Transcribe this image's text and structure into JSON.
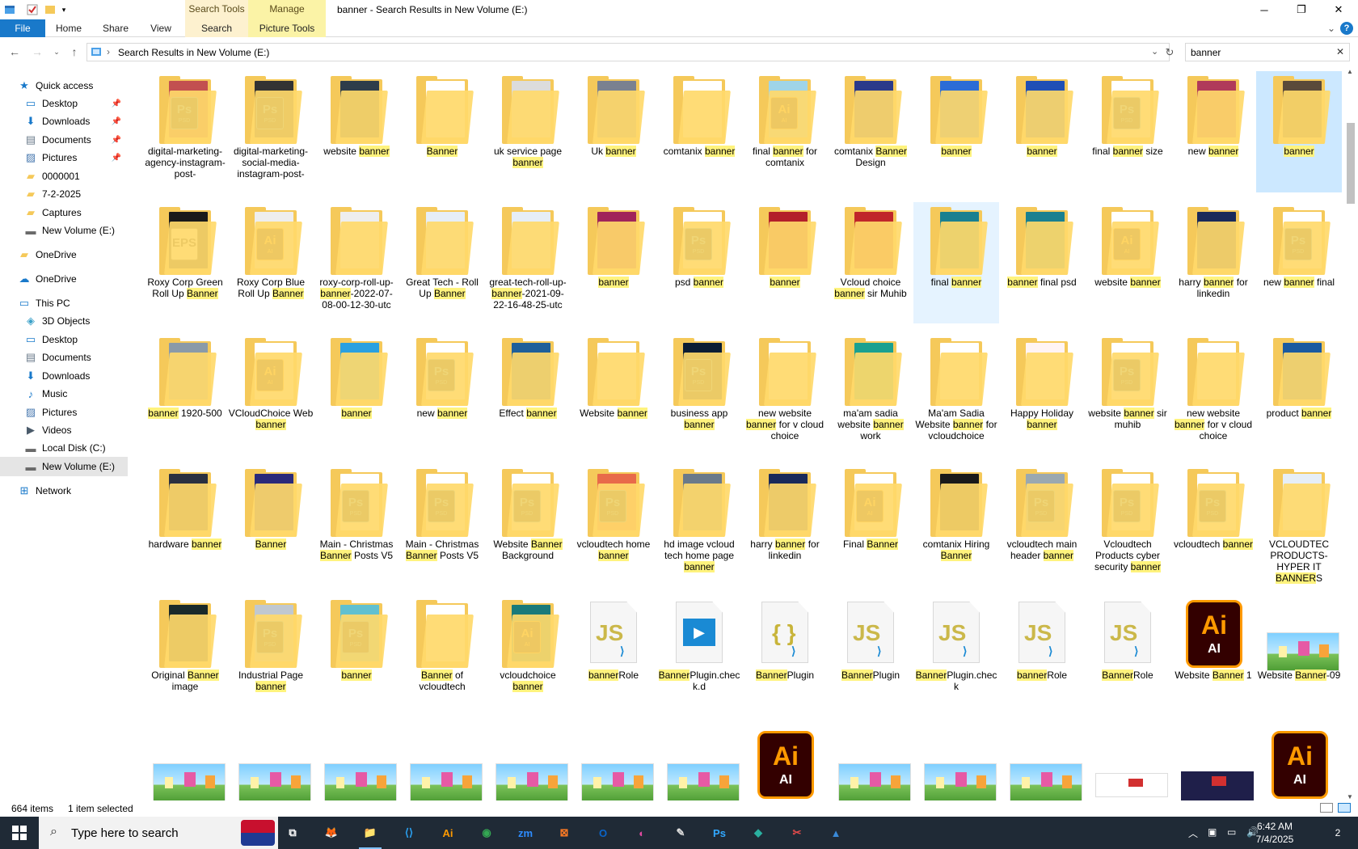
{
  "window": {
    "title": "banner - Search Results in New Volume (E:)",
    "controls": {
      "minimize": "─",
      "maximize": "❐",
      "close": "✕"
    }
  },
  "ribbon": {
    "context_tabs": [
      {
        "group": "Search Tools",
        "tab": "Search"
      },
      {
        "group": "Manage",
        "tab": "Picture Tools"
      }
    ],
    "tabs": [
      "File",
      "Home",
      "Share",
      "View"
    ],
    "collapse": "⌄",
    "help": "?"
  },
  "address": {
    "path": "Search Results in New Volume (E:)",
    "search_query": "banner",
    "sep": "›"
  },
  "nav_pane": [
    {
      "label": "Quick access",
      "icon": "star-icon",
      "pinned": false
    },
    {
      "label": "Desktop",
      "icon": "desktop-icon",
      "pinned": true
    },
    {
      "label": "Downloads",
      "icon": "download-icon",
      "pinned": true
    },
    {
      "label": "Documents",
      "icon": "documents-icon",
      "pinned": true
    },
    {
      "label": "Pictures",
      "icon": "pictures-icon",
      "pinned": true
    },
    {
      "label": "0000001",
      "icon": "folder-icon",
      "pinned": false
    },
    {
      "label": "7-2-2025",
      "icon": "folder-icon",
      "pinned": false
    },
    {
      "label": "Captures",
      "icon": "folder-icon",
      "pinned": false
    },
    {
      "label": "New Volume (E:)",
      "icon": "drive-icon",
      "pinned": false
    },
    {
      "label": "OneDrive",
      "icon": "folder-icon",
      "pinned": false
    },
    {
      "label": "OneDrive",
      "icon": "cloud-icon",
      "pinned": false
    },
    {
      "label": "This PC",
      "icon": "pc-icon",
      "pinned": false
    },
    {
      "label": "3D Objects",
      "icon": "cube-icon",
      "pinned": false
    },
    {
      "label": "Desktop",
      "icon": "desktop-icon",
      "pinned": false
    },
    {
      "label": "Documents",
      "icon": "documents-icon",
      "pinned": false
    },
    {
      "label": "Downloads",
      "icon": "download-icon",
      "pinned": false
    },
    {
      "label": "Music",
      "icon": "music-icon",
      "pinned": false
    },
    {
      "label": "Pictures",
      "icon": "pictures-icon",
      "pinned": false
    },
    {
      "label": "Videos",
      "icon": "videos-icon",
      "pinned": false
    },
    {
      "label": "Local Disk (C:)",
      "icon": "disk-icon",
      "pinned": false
    },
    {
      "label": "New Volume (E:)",
      "icon": "drive-icon",
      "pinned": false
    },
    {
      "label": "Network",
      "icon": "network-icon",
      "pinned": false
    }
  ],
  "items": [
    {
      "label": "digital-marketing-agency-instagram-post-",
      "kind": "folder",
      "badge": "PS",
      "color": "#c25050"
    },
    {
      "label": "digital-marketing-social-media-instagram-post-",
      "kind": "folder",
      "badge": "PS",
      "color": "#333333"
    },
    {
      "label": "website banner",
      "kind": "folder",
      "badge": "",
      "color": "#2e3d4a"
    },
    {
      "label": "Banner",
      "kind": "folder",
      "badge": "",
      "color": "#ffffff"
    },
    {
      "label": "uk service page banner",
      "kind": "folder",
      "badge": "",
      "color": "#dcdcdc"
    },
    {
      "label": "Uk banner",
      "kind": "folder",
      "badge": "",
      "color": "#7a8190"
    },
    {
      "label": "comtanix banner",
      "kind": "folder",
      "badge": "",
      "color": "#ffffff"
    },
    {
      "label": "final banner for comtanix",
      "kind": "folder",
      "badge": "AI",
      "color": "#9fd4e8"
    },
    {
      "label": "comtanix Banner Design",
      "kind": "folder",
      "badge": "",
      "color": "#2a3a8a"
    },
    {
      "label": "banner",
      "kind": "folder",
      "badge": "",
      "color": "#2b6cd6"
    },
    {
      "label": "banner",
      "kind": "folder",
      "badge": "",
      "color": "#1f4fb5"
    },
    {
      "label": "final banner size",
      "kind": "folder",
      "badge": "PS",
      "color": "#ffffff"
    },
    {
      "label": "new banner",
      "kind": "folder",
      "badge": "",
      "color": "#b03a5a"
    },
    {
      "label": "banner",
      "kind": "folder",
      "badge": "",
      "color": "#5a4a3a"
    },
    {
      "label": "Roxy Corp Green Roll Up Banner",
      "kind": "folder",
      "badge": "EPS",
      "color": "#1a1a1a"
    },
    {
      "label": "Roxy Corp Blue Roll Up Banner",
      "kind": "folder",
      "badge": "AI",
      "color": "#eeeeee"
    },
    {
      "label": "roxy-corp-roll-up-banner-2022-07-08-00-12-30-utc",
      "kind": "folder",
      "badge": "",
      "color": "#eeeeee"
    },
    {
      "label": "Great Tech - Roll Up Banner",
      "kind": "folder",
      "badge": "",
      "color": "#e6eef6"
    },
    {
      "label": "great-tech-roll-up-banner-2021-09-22-16-48-25-utc",
      "kind": "folder",
      "badge": "",
      "color": "#e6eef6"
    },
    {
      "label": "banner",
      "kind": "folder",
      "badge": "",
      "color": "#a0245a"
    },
    {
      "label": "psd banner",
      "kind": "folder",
      "badge": "PS",
      "color": "#ffffff"
    },
    {
      "label": "banner",
      "kind": "folder",
      "badge": "",
      "color": "#b31f2a"
    },
    {
      "label": "Vcloud choice banner sir Muhib",
      "kind": "folder",
      "badge": "",
      "color": "#c0262a"
    },
    {
      "label": "final banner",
      "kind": "folder",
      "badge": "",
      "color": "#1a8090"
    },
    {
      "label": "banner final psd",
      "kind": "folder",
      "badge": "",
      "color": "#1a8090"
    },
    {
      "label": "website banner",
      "kind": "folder",
      "badge": "AI",
      "color": "#ffffff"
    },
    {
      "label": "harry banner for linkedin",
      "kind": "folder",
      "badge": "",
      "color": "#1a2a5a"
    },
    {
      "label": "new banner final",
      "kind": "folder",
      "badge": "PS",
      "color": "#ffffff"
    },
    {
      "label": "banner 1920-500",
      "kind": "folder",
      "badge": "",
      "color": "#8a9aa8"
    },
    {
      "label": "VCloudChoice Web banner",
      "kind": "folder",
      "badge": "AI",
      "color": "#ffffff"
    },
    {
      "label": "banner",
      "kind": "folder",
      "badge": "",
      "color": "#29a0e0"
    },
    {
      "label": "new banner",
      "kind": "folder",
      "badge": "PS",
      "color": "#ffffff"
    },
    {
      "label": "Effect banner",
      "kind": "folder",
      "badge": "",
      "color": "#1e5f9a"
    },
    {
      "label": "Website banner",
      "kind": "folder",
      "badge": "",
      "color": "#ffffff"
    },
    {
      "label": "business app banner",
      "kind": "folder",
      "badge": "PS",
      "color": "#0a1d34"
    },
    {
      "label": "new website banner for v cloud choice",
      "kind": "folder",
      "badge": "",
      "color": "#ffffff"
    },
    {
      "label": "ma'am sadia website banner work",
      "kind": "folder",
      "badge": "",
      "color": "#1aa090"
    },
    {
      "label": "Ma'am  Sadia Website banner for vcloudchoice",
      "kind": "folder",
      "badge": "",
      "color": "#ffffff"
    },
    {
      "label": "Happy Holiday banner",
      "kind": "folder",
      "badge": "",
      "color": "#fff4f4"
    },
    {
      "label": "website banner sir muhib",
      "kind": "folder",
      "badge": "PS",
      "color": "#ffffff"
    },
    {
      "label": "new website banner for v cloud choice",
      "kind": "folder",
      "badge": "",
      "color": "#ffffff"
    },
    {
      "label": "product banner",
      "kind": "folder",
      "badge": "",
      "color": "#1a5aa0"
    },
    {
      "label": "hardware banner",
      "kind": "folder",
      "badge": "",
      "color": "#2a3040"
    },
    {
      "label": "Banner",
      "kind": "folder",
      "badge": "",
      "color": "#2a2a7a"
    },
    {
      "label": "Main - Christmas Banner Posts V5",
      "kind": "folder",
      "badge": "PS",
      "color": "#ffffff"
    },
    {
      "label": "Main - Christmas Banner Posts V5",
      "kind": "folder",
      "badge": "PS",
      "color": "#ffffff"
    },
    {
      "label": "Website Banner Background",
      "kind": "folder",
      "badge": "PS",
      "color": "#ffffff"
    },
    {
      "label": "vcloudtech home banner",
      "kind": "folder",
      "badge": "PS",
      "color": "#e86a4a"
    },
    {
      "label": "hd image vcloud tech home page banner",
      "kind": "folder",
      "badge": "",
      "color": "#6a7a8a"
    },
    {
      "label": "harry banner for linkedin",
      "kind": "folder",
      "badge": "",
      "color": "#1a2a5a"
    },
    {
      "label": "Final Banner",
      "kind": "folder",
      "badge": "AI",
      "color": "#ffffff"
    },
    {
      "label": "comtanix Hiring Banner",
      "kind": "folder",
      "badge": "",
      "color": "#1a1a1a"
    },
    {
      "label": "vcloudtech main header banner",
      "kind": "folder",
      "badge": "PS",
      "color": "#9aa8b0"
    },
    {
      "label": "Vcloudtech Products cyber security banner",
      "kind": "folder",
      "badge": "PS",
      "color": "#ffffff"
    },
    {
      "label": "vcloudtech banner",
      "kind": "folder",
      "badge": "PS",
      "color": "#ffffff"
    },
    {
      "label": "VCLOUDTEC PRODUCTS-HYPER IT BANNERS",
      "kind": "folder",
      "badge": "",
      "color": "#e6eef6"
    },
    {
      "label": "Original Banner image",
      "kind": "folder",
      "badge": "",
      "color": "#1a2a2a"
    },
    {
      "label": "Industrial Page banner",
      "kind": "folder",
      "badge": "PS",
      "color": "#c0c8d0"
    },
    {
      "label": "banner",
      "kind": "folder",
      "badge": "PS",
      "color": "#60c0d0"
    },
    {
      "label": "Banner of vcloudtech",
      "kind": "folder",
      "badge": "",
      "color": "#ffffff"
    },
    {
      "label": "vcloudchoice banner",
      "kind": "folder",
      "badge": "AI",
      "color": "#1a7a7a"
    },
    {
      "label": "bannerRole",
      "kind": "js",
      "badge": "JS",
      "color": ""
    },
    {
      "label": "BannerPlugin.check.d",
      "kind": "video",
      "badge": "",
      "color": ""
    },
    {
      "label": "BannerPlugin",
      "kind": "json",
      "badge": "{ }",
      "color": ""
    },
    {
      "label": "BannerPlugin",
      "kind": "js",
      "badge": "JS",
      "color": ""
    },
    {
      "label": "BannerPlugin.check",
      "kind": "js",
      "badge": "JS",
      "color": ""
    },
    {
      "label": "bannerRole",
      "kind": "js",
      "badge": "JS",
      "color": ""
    },
    {
      "label": "BannerRole",
      "kind": "js",
      "badge": "JS",
      "color": ""
    },
    {
      "label": "Website Banner 1",
      "kind": "aifile",
      "badge": "Ai",
      "color": ""
    },
    {
      "label": "Website Banner-09",
      "kind": "image",
      "badge": "",
      "color": ""
    }
  ],
  "row6": [
    {
      "kind": "image"
    },
    {
      "kind": "image"
    },
    {
      "kind": "image"
    },
    {
      "kind": "image"
    },
    {
      "kind": "image"
    },
    {
      "kind": "image"
    },
    {
      "kind": "image"
    },
    {
      "kind": "aifile"
    },
    {
      "kind": "image"
    },
    {
      "kind": "image"
    },
    {
      "kind": "image"
    },
    {
      "kind": "redimage"
    },
    {
      "kind": "darkimage"
    },
    {
      "kind": "aifile"
    }
  ],
  "selection": {
    "selected_index": 13,
    "hover_index": 23
  },
  "highlight_term": "banner",
  "status": {
    "count": "664 items",
    "selected": "1 item selected"
  },
  "taskbar": {
    "search_placeholder": "Type here to search",
    "apps": [
      {
        "name": "task-view",
        "glyph": "⧉"
      },
      {
        "name": "firefox",
        "glyph": "🦊"
      },
      {
        "name": "file-explorer",
        "glyph": "📁"
      },
      {
        "name": "vscode",
        "glyph": "⟨⟩"
      },
      {
        "name": "illustrator",
        "glyph": "Ai"
      },
      {
        "name": "chrome",
        "glyph": "◉"
      },
      {
        "name": "zoom",
        "glyph": "zm"
      },
      {
        "name": "xampp",
        "glyph": "⊠"
      },
      {
        "name": "outlook",
        "glyph": "O"
      },
      {
        "name": "photos",
        "glyph": "◐"
      },
      {
        "name": "pen-tool",
        "glyph": "✎"
      },
      {
        "name": "photoshop",
        "glyph": "Ps"
      },
      {
        "name": "app-green",
        "glyph": "◆"
      },
      {
        "name": "app-red",
        "glyph": "✂"
      },
      {
        "name": "app-blue",
        "glyph": "▲"
      }
    ],
    "time": "6:42 AM",
    "date": "7/4/2025",
    "notifications": "2"
  },
  "colors": {
    "accent": "#1979ca",
    "highlight": "#fff37d",
    "selected": "#cce8ff",
    "taskbar": "#1f2a36"
  }
}
